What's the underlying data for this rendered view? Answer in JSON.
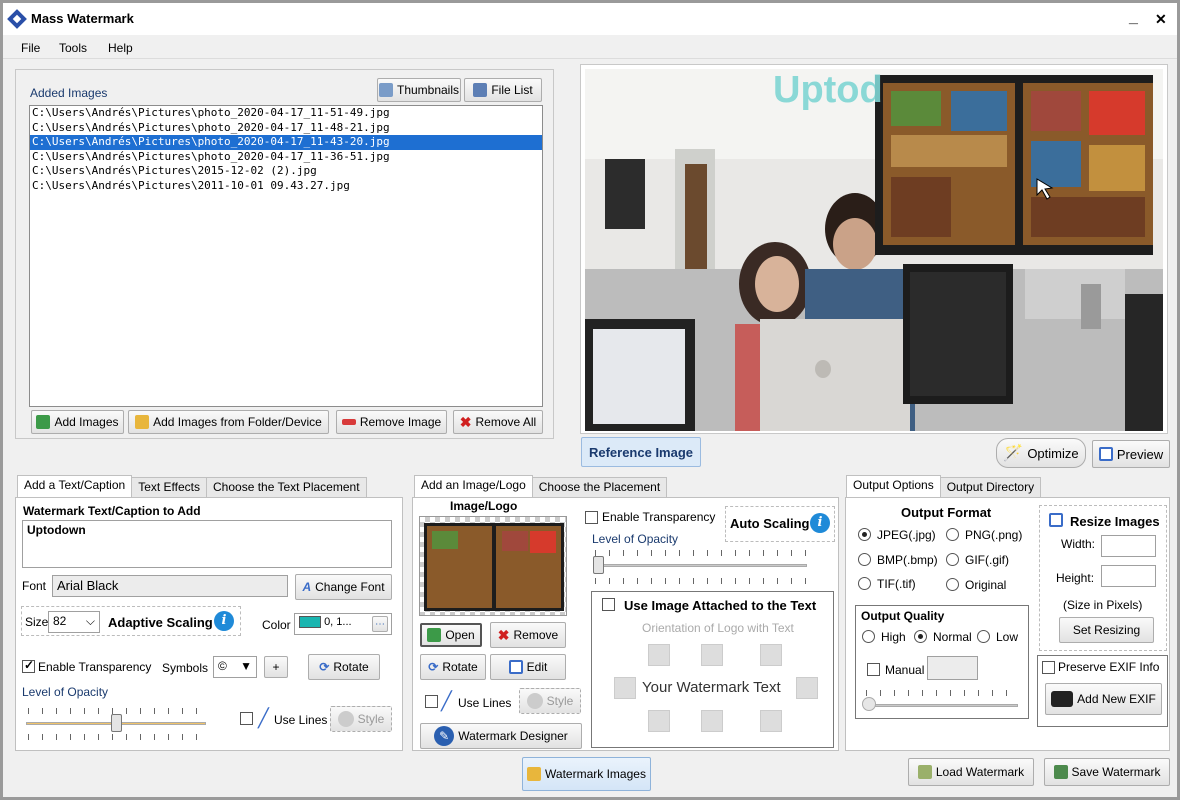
{
  "window": {
    "title": "Mass Watermark",
    "minimize": "_",
    "close": "✕"
  },
  "menu": [
    "File",
    "Tools",
    "Help"
  ],
  "images_panel": {
    "label": "Added Images",
    "thumbnails_btn": "Thumbnails",
    "filelist_btn": "File List",
    "files": [
      "C:\\Users\\Andrés\\Pictures\\photo_2020-04-17_11-51-49.jpg",
      "C:\\Users\\Andrés\\Pictures\\photo_2020-04-17_11-48-21.jpg",
      "C:\\Users\\Andrés\\Pictures\\photo_2020-04-17_11-43-20.jpg",
      "C:\\Users\\Andrés\\Pictures\\photo_2020-04-17_11-36-51.jpg",
      "C:\\Users\\Andrés\\Pictures\\2015-12-02 (2).jpg",
      "C:\\Users\\Andrés\\Pictures\\2011-10-01 09.43.27.jpg"
    ],
    "selected_index": 2,
    "add_images": "Add Images",
    "add_folder": "Add Images from Folder/Device",
    "remove_image": "Remove Image",
    "remove_all": "Remove All"
  },
  "preview": {
    "watermark_text": "Uptod",
    "reference_label": "Reference Image",
    "optimize": "Optimize",
    "preview": "Preview"
  },
  "text_tabs": [
    "Add a Text/Caption",
    "Text Effects",
    "Choose the Text Placement"
  ],
  "text_panel": {
    "caption_label": "Watermark Text/Caption to Add",
    "caption_value": "Uptodown",
    "font_label": "Font",
    "font_value": "Arial Black",
    "change_font": "Change Font",
    "size_label": "Size",
    "size_value": "82",
    "adaptive_scaling": "Adaptive Scaling",
    "color_label": "Color",
    "color_value": "0, 1...",
    "color_swatch": "#1ab5b0",
    "enable_transparency": "Enable Transparency",
    "symbols_label": "Symbols",
    "symbol_value": "©",
    "plus": "+",
    "rotate": "Rotate",
    "opacity_label": "Level of Opacity",
    "opacity_level": 0.5,
    "use_lines": "Use Lines",
    "style": "Style"
  },
  "image_tabs": [
    "Add an Image/Logo",
    "Choose the Placement"
  ],
  "image_panel": {
    "image_logo_label": "Image/Logo",
    "open": "Open",
    "remove": "Remove",
    "rotate": "Rotate",
    "edit": "Edit",
    "use_lines": "Use Lines",
    "style": "Style",
    "designer": "Watermark Designer",
    "enable_transparency": "Enable Transparency",
    "auto_scaling": "Auto Scaling",
    "opacity_label": "Level of Opacity",
    "opacity_level": 0.0,
    "attach_label": "Use Image Attached to the Text",
    "orientation_label": "Orientation of Logo with Text",
    "your_text": "Your Watermark Text"
  },
  "output_tabs": [
    "Output Options",
    "Output Directory"
  ],
  "output_panel": {
    "format_title": "Output Format",
    "formats": [
      "JPEG(.jpg)",
      "PNG(.png)",
      "BMP(.bmp)",
      "GIF(.gif)",
      "TIF(.tif)",
      "Original"
    ],
    "selected_format": "JPEG(.jpg)",
    "quality_title": "Output Quality",
    "qualities": [
      "High",
      "Normal",
      "Low"
    ],
    "selected_quality": "Normal",
    "manual": "Manual",
    "resize_title": "Resize Images",
    "width_label": "Width:",
    "height_label": "Height:",
    "size_note": "(Size in Pixels)",
    "set_resizing": "Set Resizing",
    "preserve_exif": "Preserve EXIF Info",
    "add_exif": "Add New EXIF"
  },
  "bottom": {
    "watermark_images": "Watermark Images",
    "load_watermark": "Load Watermark",
    "save_watermark": "Save Watermark"
  }
}
